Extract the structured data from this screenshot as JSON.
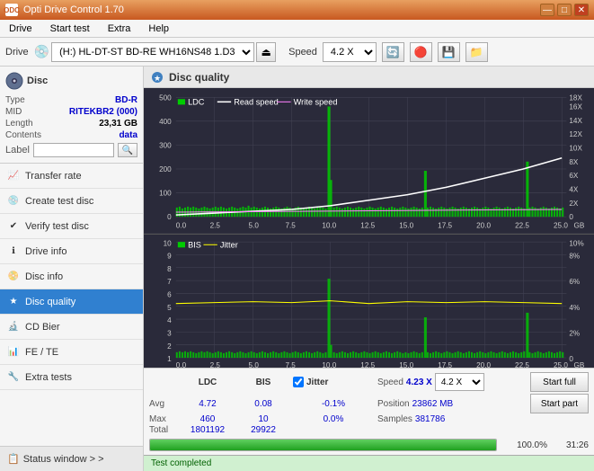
{
  "app": {
    "title": "Opti Drive Control 1.70",
    "icon": "ODC"
  },
  "titlebar": {
    "minimize": "—",
    "maximize": "□",
    "close": "✕"
  },
  "menu": {
    "items": [
      "Drive",
      "Start test",
      "Extra",
      "Help"
    ]
  },
  "toolbar": {
    "drive_label": "Drive",
    "drive_value": "(H:) HL-DT-ST BD-RE  WH16NS48 1.D3",
    "speed_label": "Speed",
    "speed_value": "4.2 X"
  },
  "disc": {
    "title": "Disc",
    "type_label": "Type",
    "type_value": "BD-R",
    "mid_label": "MID",
    "mid_value": "RITEKBR2 (000)",
    "length_label": "Length",
    "length_value": "23,31 GB",
    "contents_label": "Contents",
    "contents_value": "data",
    "label_label": "Label",
    "label_value": ""
  },
  "nav": {
    "items": [
      {
        "id": "transfer-rate",
        "label": "Transfer rate",
        "icon": "📈"
      },
      {
        "id": "create-test-disc",
        "label": "Create test disc",
        "icon": "💿"
      },
      {
        "id": "verify-test-disc",
        "label": "Verify test disc",
        "icon": "✔"
      },
      {
        "id": "drive-info",
        "label": "Drive info",
        "icon": "ℹ"
      },
      {
        "id": "disc-info",
        "label": "Disc info",
        "icon": "📀"
      },
      {
        "id": "disc-quality",
        "label": "Disc quality",
        "icon": "★",
        "active": true
      },
      {
        "id": "cd-bier",
        "label": "CD Bier",
        "icon": "🔬"
      },
      {
        "id": "fe-te",
        "label": "FE / TE",
        "icon": "📊"
      },
      {
        "id": "extra-tests",
        "label": "Extra tests",
        "icon": "🔧"
      }
    ],
    "status_window": "Status window > >"
  },
  "disc_quality": {
    "title": "Disc quality",
    "legend": {
      "ldc": "LDC",
      "read_speed": "Read speed",
      "write_speed": "Write speed"
    },
    "legend2": {
      "bis": "BIS",
      "jitter": "Jitter"
    },
    "chart1": {
      "y_max": 500,
      "y_right_max": 18,
      "x_max": 25,
      "x_label": "GB",
      "y_ticks": [
        100,
        200,
        300,
        400,
        500
      ],
      "x_ticks": [
        0.0,
        2.5,
        5.0,
        7.5,
        10.0,
        12.5,
        15.0,
        17.5,
        20.0,
        22.5,
        25.0
      ],
      "right_ticks": [
        2,
        4,
        6,
        8,
        10,
        12,
        14,
        16,
        18
      ]
    },
    "chart2": {
      "y_max": 10,
      "y_right_max": 10,
      "x_max": 25,
      "x_label": "GB",
      "y_ticks": [
        1,
        2,
        3,
        4,
        5,
        6,
        7,
        8,
        9,
        10
      ],
      "x_ticks": [
        0.0,
        2.5,
        5.0,
        7.5,
        10.0,
        12.5,
        15.0,
        17.5,
        20.0,
        22.5,
        25.0
      ],
      "right_ticks": [
        "2%",
        "4%",
        "6%",
        "8%",
        "10%"
      ]
    }
  },
  "stats": {
    "columns": [
      "LDC",
      "BIS"
    ],
    "jitter_label": "Jitter",
    "jitter_checked": true,
    "speed_label": "Speed",
    "speed_value": "4.23 X",
    "speed_select": "4.2 X",
    "position_label": "Position",
    "position_value": "23862 MB",
    "samples_label": "Samples",
    "samples_value": "381786",
    "rows": [
      {
        "label": "Avg",
        "ldc": "4.72",
        "bis": "0.08",
        "jitter": "-0.1%"
      },
      {
        "label": "Max",
        "ldc": "460",
        "bis": "10",
        "jitter": "0.0%"
      },
      {
        "label": "Total",
        "ldc": "1801192",
        "bis": "29922",
        "jitter": ""
      }
    ],
    "btn_start_full": "Start full",
    "btn_start_part": "Start part"
  },
  "progress": {
    "value": 100,
    "text": "100.0%",
    "time": "31:26"
  },
  "status": {
    "text": "Test completed"
  }
}
